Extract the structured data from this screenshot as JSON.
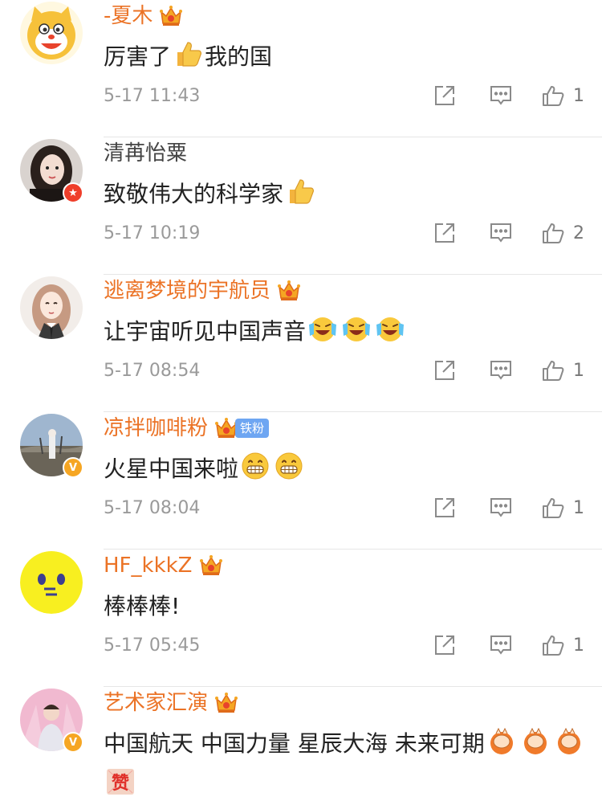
{
  "colors": {
    "vip_name": "#eb7326",
    "normal_name": "#444444",
    "time": "#9a9a9a",
    "divider": "#e6e6e6",
    "fan_badge": "#6ea6f2"
  },
  "comments": [
    {
      "username": "-夏木",
      "vip": true,
      "has_fan_badge": false,
      "badge": "none",
      "avatar": "cartoon-cat-avatar",
      "text": "厉害了",
      "emojis_inline": [
        "thumbs-up-emoji"
      ],
      "text_after": "我的国",
      "time": "5-17 11:43",
      "likes": "1"
    },
    {
      "username": "清苒怡粟",
      "vip": false,
      "has_fan_badge": false,
      "badge": "red-badge",
      "avatar": "girl-photo-avatar",
      "text": "致敬伟大的科学家",
      "emojis_inline": [
        "thumbs-up-emoji"
      ],
      "text_after": "",
      "time": "5-17 10:19",
      "likes": "2"
    },
    {
      "username": "逃离梦境的宇航员",
      "vip": true,
      "has_fan_badge": false,
      "badge": "none",
      "avatar": "anime-girl-avatar",
      "text": "让宇宙听见中国声音",
      "emojis_inline": [
        "laugh-cry-emoji",
        "laugh-cry-emoji",
        "laugh-cry-emoji"
      ],
      "text_after": "",
      "time": "5-17 08:54",
      "likes": "1"
    },
    {
      "username": "凉拌咖啡粉",
      "vip": true,
      "has_fan_badge": true,
      "fan_badge_label": "铁粉",
      "badge": "yellow-v",
      "avatar": "landscape-avatar",
      "text": "火星中国来啦",
      "emojis_inline": [
        "grin-emoji",
        "grin-emoji"
      ],
      "text_after": "",
      "time": "5-17 08:04",
      "likes": "1"
    },
    {
      "username": "HF_kkkZ",
      "vip": true,
      "has_fan_badge": false,
      "badge": "none",
      "avatar": "yellow-face-avatar",
      "text": "棒棒棒!",
      "emojis_inline": [],
      "text_after": "",
      "time": "5-17 05:45",
      "likes": "1"
    },
    {
      "username": "艺术家汇演",
      "vip": true,
      "has_fan_badge": false,
      "badge": "yellow-v",
      "avatar": "person-photo-avatar",
      "text": "中国航天  中国力量 星辰大海 未来可期",
      "emojis_inline": [
        "fist-emoji",
        "fist-emoji",
        "fist-emoji",
        "zan-emoji"
      ],
      "text_after": "",
      "zan_label": "赞",
      "time": "",
      "likes": ""
    }
  ],
  "badges": {
    "vip_v": "V",
    "red_badge_symbol": "★"
  },
  "icons": {
    "share": "share-icon",
    "reply": "reply-icon",
    "like": "like-icon",
    "crown": "crown-icon"
  }
}
